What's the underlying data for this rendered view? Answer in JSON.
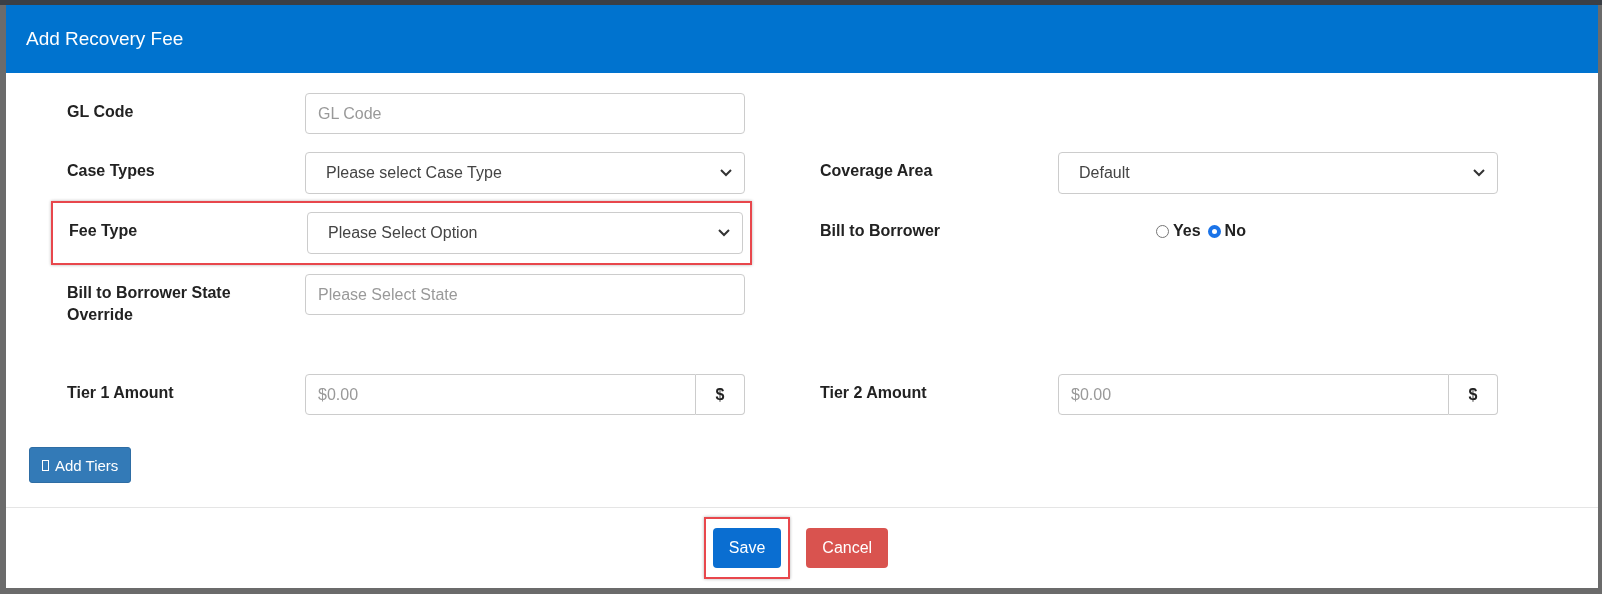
{
  "dialog": {
    "title": "Add Recovery Fee"
  },
  "fields": [
    {
      "kind": "text",
      "label": "GL Code",
      "placeholder": "GL Code",
      "highlighted": false
    },
    {
      "kind": "select",
      "label": "Case Types",
      "value": "Please select Case Type",
      "highlighted": false
    },
    {
      "kind": "select",
      "label": "Coverage Area",
      "value": "Default",
      "highlighted": false
    },
    {
      "kind": "select",
      "label": "Fee Type",
      "value": "Please Select Option",
      "highlighted": true
    },
    {
      "kind": "radio",
      "label": "Bill to Borrower",
      "options": [
        {
          "label": "Yes",
          "selected": false
        },
        {
          "label": "No",
          "selected": true
        }
      ],
      "highlighted": false
    },
    {
      "kind": "text",
      "label": "Bill to Borrower State Override",
      "placeholder": "Please Select State",
      "highlighted": false
    },
    {
      "kind": "money",
      "label": "Tier 1 Amount",
      "placeholder": "$0.00",
      "addon": "$",
      "highlighted": false
    },
    {
      "kind": "money",
      "label": "Tier 2 Amount",
      "placeholder": "$0.00",
      "addon": "$",
      "highlighted": false
    }
  ],
  "add_button": {
    "label": "Add Tiers"
  },
  "footer_buttons": [
    {
      "kind": "primary",
      "label": "Save",
      "highlighted": true
    },
    {
      "kind": "danger",
      "label": "Cancel",
      "highlighted": false
    }
  ]
}
